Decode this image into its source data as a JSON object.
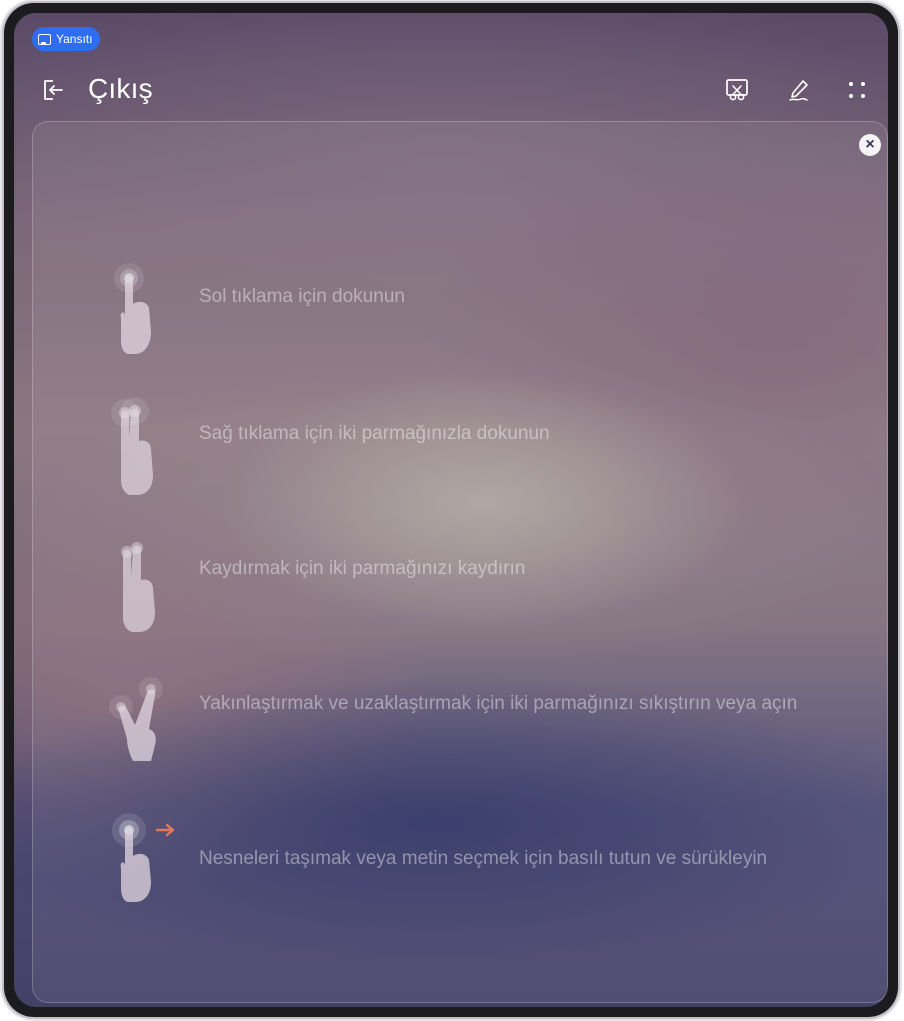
{
  "status_badge": {
    "label": "Yansıtı",
    "icon": "cast-icon",
    "color": "#2f6df0"
  },
  "header": {
    "title": "Çıkış",
    "exit_icon": "exit-icon",
    "actions": [
      "screenshot-icon",
      "annotate-pen-icon",
      "more-icon"
    ]
  },
  "guide": {
    "close_icon": "close-icon",
    "items": [
      {
        "icon": "single-finger-tap-icon",
        "label": "Sol tıklama için dokunun"
      },
      {
        "icon": "two-finger-tap-icon",
        "label": "Sağ tıklama için iki parmağınızla dokunun"
      },
      {
        "icon": "two-finger-scroll-icon",
        "label": "Kaydırmak için iki parmağınızı kaydırın"
      },
      {
        "icon": "pinch-zoom-icon",
        "label": "Yakınlaştırmak ve uzaklaştırmak için iki parmağınızı sıkıştırın veya açın"
      },
      {
        "icon": "press-and-drag-icon",
        "label": "Nesneleri taşımak veya metin seçmek için basılı tutun ve sürükleyin"
      }
    ]
  },
  "colors": {
    "drag_arrow": "#e07a5f",
    "text": "#ffffff"
  }
}
